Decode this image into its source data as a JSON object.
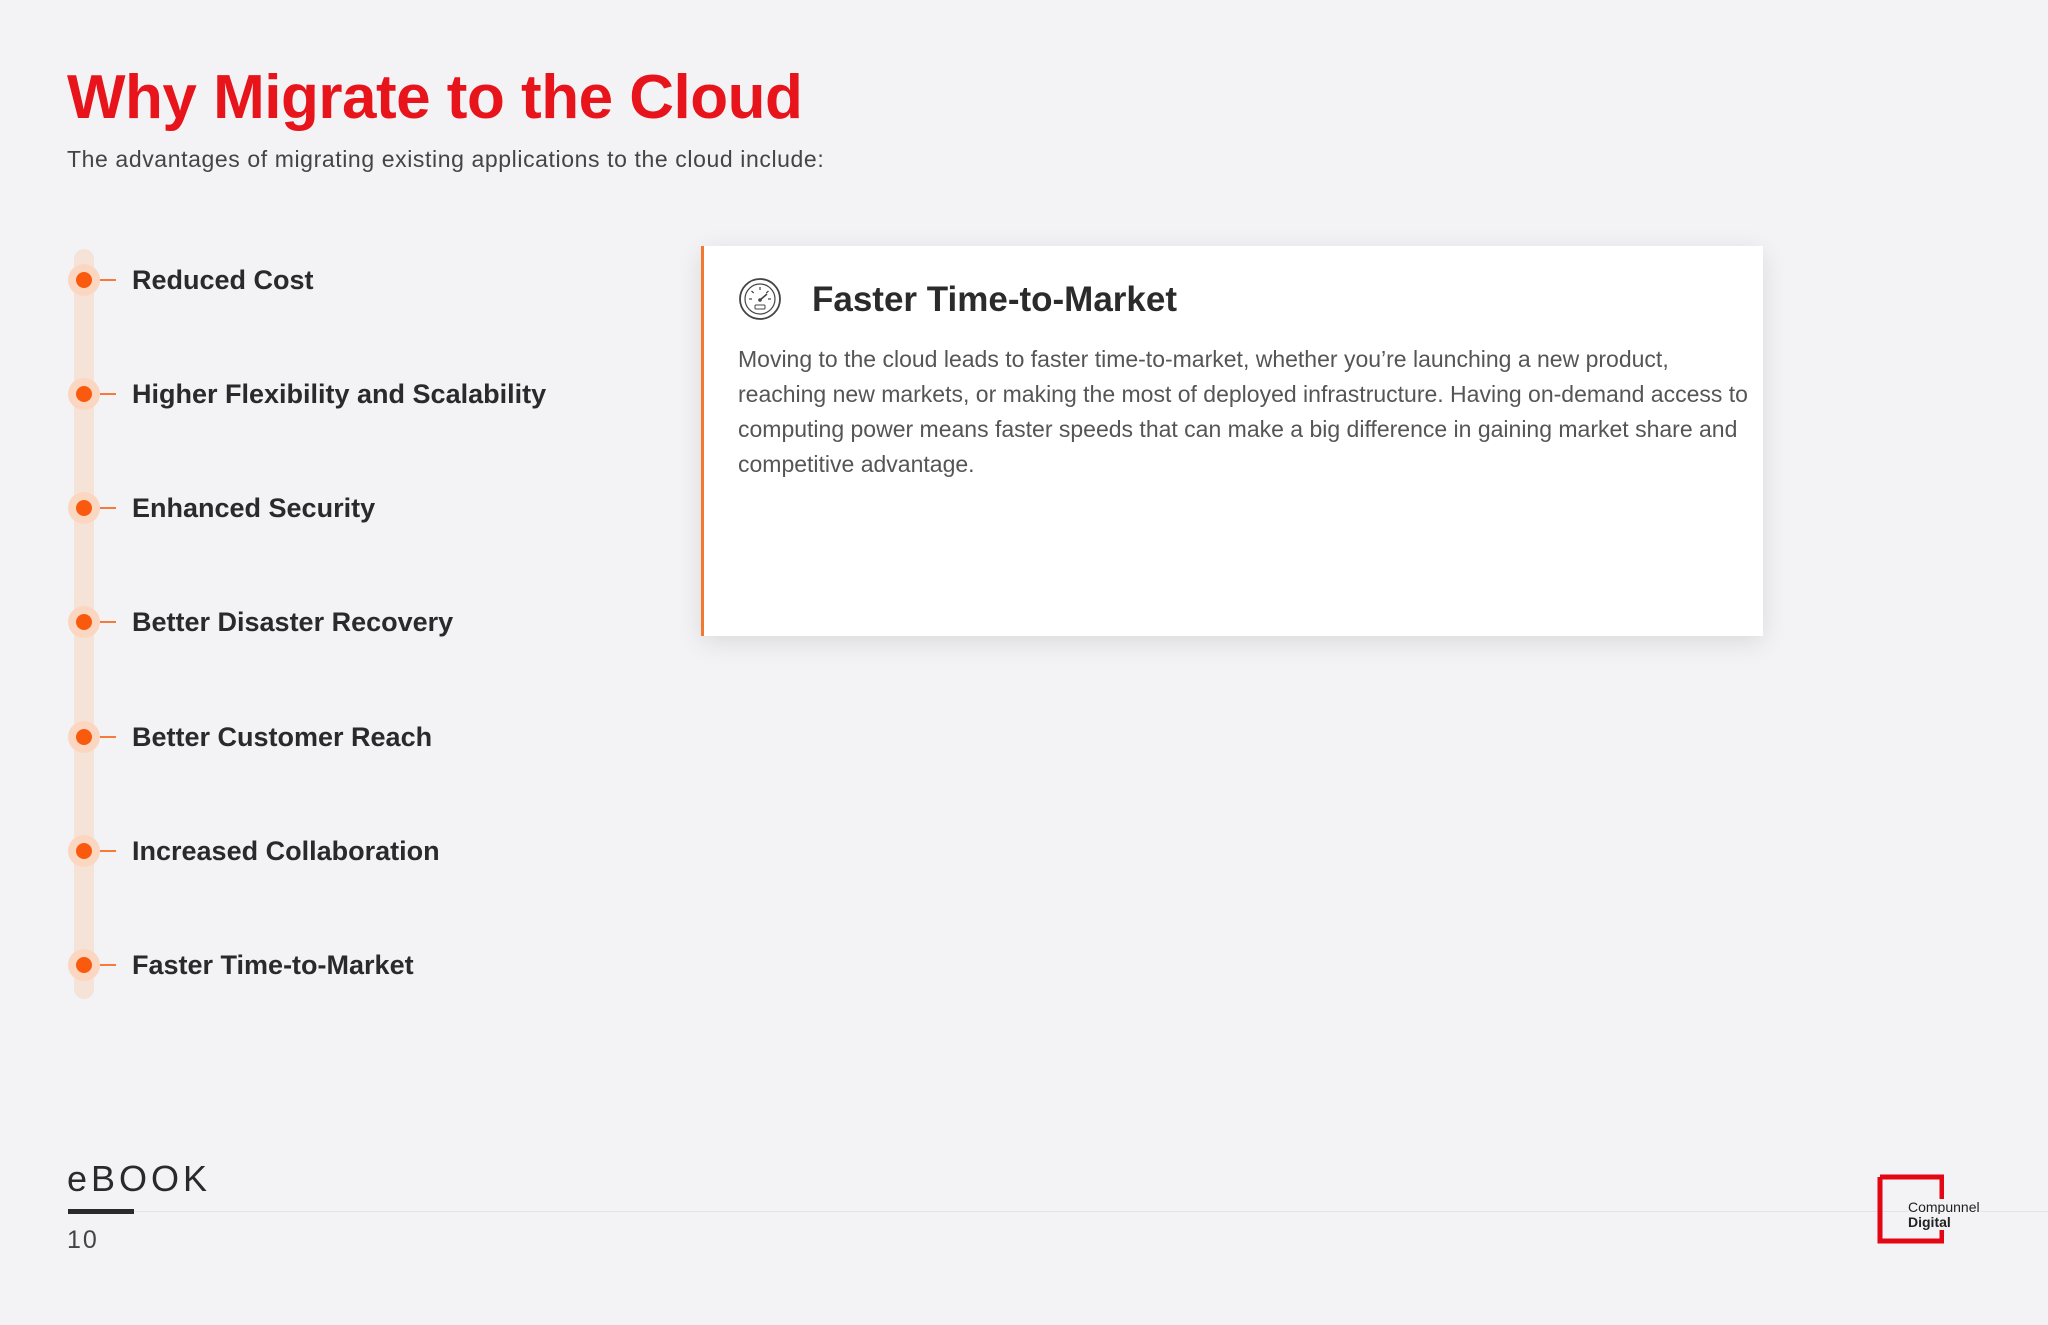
{
  "header": {
    "title": "Why Migrate to the Cloud",
    "subtitle": "The advantages of migrating existing applications to the cloud include:"
  },
  "timeline": {
    "items": [
      {
        "label": "Reduced Cost"
      },
      {
        "label": "Higher Flexibility and Scalability"
      },
      {
        "label": "Enhanced Security"
      },
      {
        "label": "Better Disaster Recovery"
      },
      {
        "label": "Better Customer Reach"
      },
      {
        "label": "Increased Collaboration"
      },
      {
        "label": "Faster Time-to-Market"
      }
    ]
  },
  "detail_card": {
    "icon": "speedometer-icon",
    "title": "Faster Time-to-Market",
    "body": "Moving to the cloud leads to faster time-to-market, whether you’re launching a new product, reaching new markets, or making the most of deployed infrastructure. Having on-demand access to computing power means faster speeds that can make a big difference in gaining market share and competitive advantage."
  },
  "footer": {
    "label": "eBOOK",
    "page_number": "10"
  },
  "logo": {
    "line1": "Compunnel",
    "line2": "Digital"
  },
  "colors": {
    "title_red": "#e8141b",
    "accent_orange": "#fa5a0e",
    "background": "#f3f2f4"
  }
}
